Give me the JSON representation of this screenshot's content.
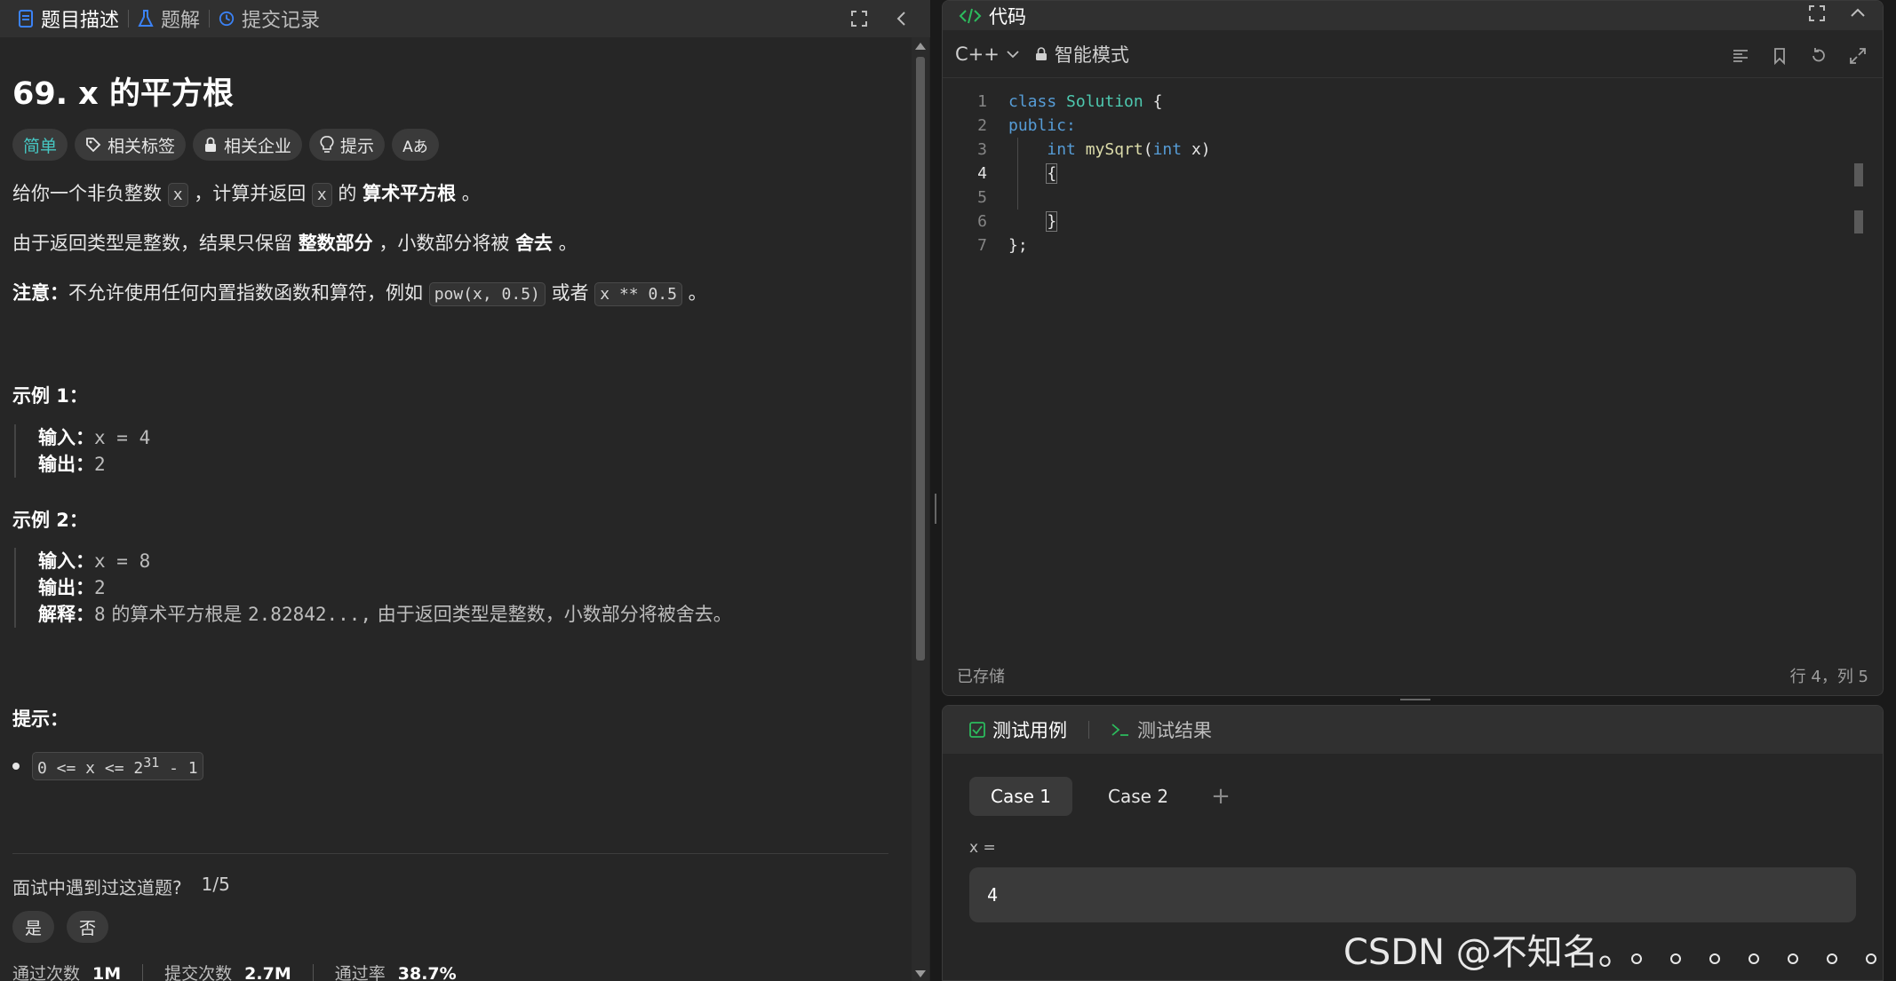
{
  "left_tabs": [
    "题目描述",
    "题解",
    "提交记录"
  ],
  "problem": {
    "title": "69. x 的平方根",
    "difficulty": "简单",
    "chips": [
      "相关标签",
      "相关企业",
      "提示"
    ],
    "font_chip": "Aあ",
    "desc1": {
      "pre": "给你一个非负整数 ",
      "code1": "x",
      "mid": " ，计算并返回 ",
      "code2": "x",
      "mid2": " 的 ",
      "bold": "算术平方根",
      "post": " 。"
    },
    "desc2": {
      "pre": "由于返回类型是整数，结果只保留 ",
      "bold1": "整数部分",
      "mid": " ，小数部分将被 ",
      "bold2": "舍去",
      "post": " 。"
    },
    "note": {
      "label": "注意：",
      "text": "不允许使用任何内置指数函数和算符，例如 ",
      "code1": "pow(x, 0.5)",
      "mid": " 或者 ",
      "code2": "x ** 0.5",
      "post": " 。"
    },
    "example1": {
      "title": "示例 1：",
      "input_label": "输入：",
      "input": "x = 4",
      "output_label": "输出：",
      "output": "2"
    },
    "example2": {
      "title": "示例 2：",
      "input_label": "输入：",
      "input": "x = 8",
      "output_label": "输出：",
      "output": "2",
      "explain_label": "解释：",
      "explain_num": "8",
      "explain_text1": " 的算术平方根是 ",
      "explain_val": "2.82842...,",
      "explain_text2": " 由于返回类型是整数，小数部分将被舍去。"
    },
    "hints_title": "提示：",
    "constraint": {
      "pre": "0 <= x <= 2",
      "sup": "31",
      "post": " - 1"
    },
    "interview_q": "面试中遇到过这道题?",
    "interview_ratio": "1/5",
    "yes": "是",
    "no": "否",
    "stats": {
      "accepted_label": "通过次数",
      "accepted": "1M",
      "submitted_label": "提交次数",
      "submitted": "2.7M",
      "rate_label": "通过率",
      "rate": "38.7%"
    }
  },
  "code_panel": {
    "title": "代码",
    "language": "C++",
    "mode": "智能模式",
    "lines": [
      "1",
      "2",
      "3",
      "4",
      "5",
      "6",
      "7"
    ],
    "code": {
      "l1_kw": "class",
      "l1_ty": "Solution",
      "l1_rest": " {",
      "l2": "public:",
      "l3_kw": "int",
      "l3_fn": "mySqrt",
      "l3_p1": "(",
      "l3_kw2": "int",
      "l3_p2": " x)",
      "l4": "{",
      "l6": "}",
      "l7": "};"
    },
    "saved": "已存储",
    "cursor": "行 4，列 5"
  },
  "test_panel": {
    "tab1": "测试用例",
    "tab2": "测试结果",
    "cases": [
      "Case 1",
      "Case 2"
    ],
    "plus": "+",
    "var_label": "x =",
    "var_value": "4"
  },
  "watermark": "CSDN @不知名。"
}
